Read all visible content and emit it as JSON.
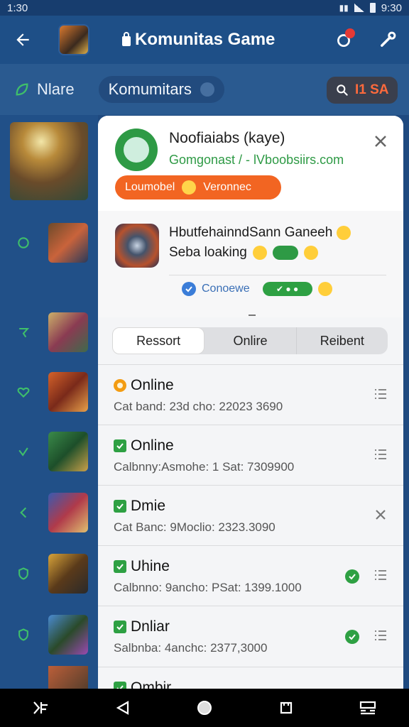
{
  "status_bar": {
    "time": "1:30",
    "right_time": "9:30"
  },
  "app_bar": {
    "title": "Komunitas Game"
  },
  "filter": {
    "name": "Nlare",
    "chip_label": "Komumitars",
    "search_count": "I1 SA"
  },
  "profile": {
    "name": "Noofiaiabs (kaye)",
    "subtitle": "Gomgonast / - lVboobsiirs.com",
    "status_text": "Loumobel",
    "status_text2": "Veronnec"
  },
  "game": {
    "title": "HbutfehainndSann Ganeeh",
    "line2": "Seba loaking",
    "connect_label": "Conoewe"
  },
  "tabs": [
    {
      "label": "Ressort",
      "active": true
    },
    {
      "label": "Onlire",
      "active": false
    },
    {
      "label": "Reibent",
      "active": false
    }
  ],
  "list": [
    {
      "title": "Online",
      "subtitle": "Cat band: 23d cho: 22023 3690",
      "marker": "orange",
      "action": "list",
      "ok": false
    },
    {
      "title": "Online",
      "subtitle": "Calbnny:Asmohe: 1 Sat: 7309900",
      "marker": "green",
      "action": "list",
      "ok": false
    },
    {
      "title": "Dmie",
      "subtitle": "Cat Banc: 9Moclio: 2323.3090",
      "marker": "green",
      "action": "close",
      "ok": false
    },
    {
      "title": "Uhine",
      "subtitle": "Calbnno: 9ancho: PSat: 1399.1000",
      "marker": "green",
      "action": "list",
      "ok": true
    },
    {
      "title": "Dnliar",
      "subtitle": "Salbnba: 4anchc: 2377,3000",
      "marker": "green",
      "action": "list",
      "ok": true
    },
    {
      "title": "Ombir",
      "subtitle": "",
      "marker": "green",
      "action": "list",
      "ok": false
    }
  ],
  "colors": {
    "primary": "#1e4f87",
    "accent_green": "#2ea043",
    "accent_orange": "#f26522"
  }
}
